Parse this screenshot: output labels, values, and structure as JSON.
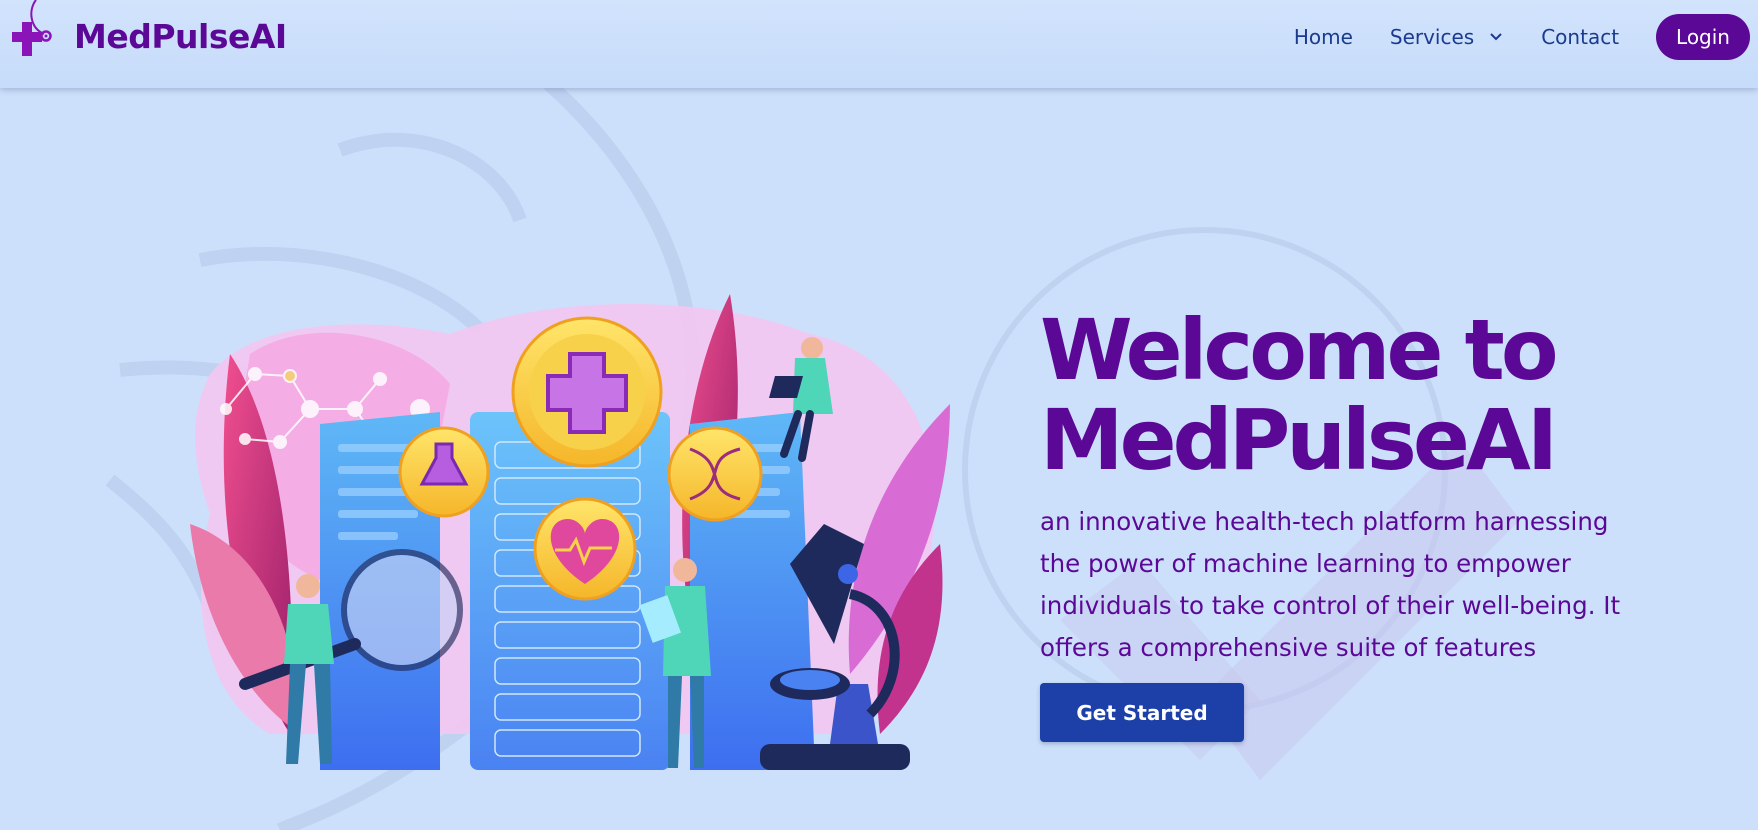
{
  "brand": {
    "name": "MedPulseAI",
    "logo_icon": "medical-cross-stethoscope-icon",
    "color": "#5b0896"
  },
  "nav": {
    "home": "Home",
    "services": "Services",
    "contact": "Contact",
    "login": "Login"
  },
  "hero": {
    "title_line1": "Welcome to",
    "title_line2": "MedPulseAI",
    "description": "an innovative health-tech platform harnessing the power of machine learning to empower individuals to take control of their well-being. It offers a comprehensive suite of features",
    "cta": "Get Started",
    "illustration": "medical-research-illustration"
  },
  "colors": {
    "background": "#cde0fb",
    "accent": "#5b0896",
    "button": "#1d3fa8"
  }
}
